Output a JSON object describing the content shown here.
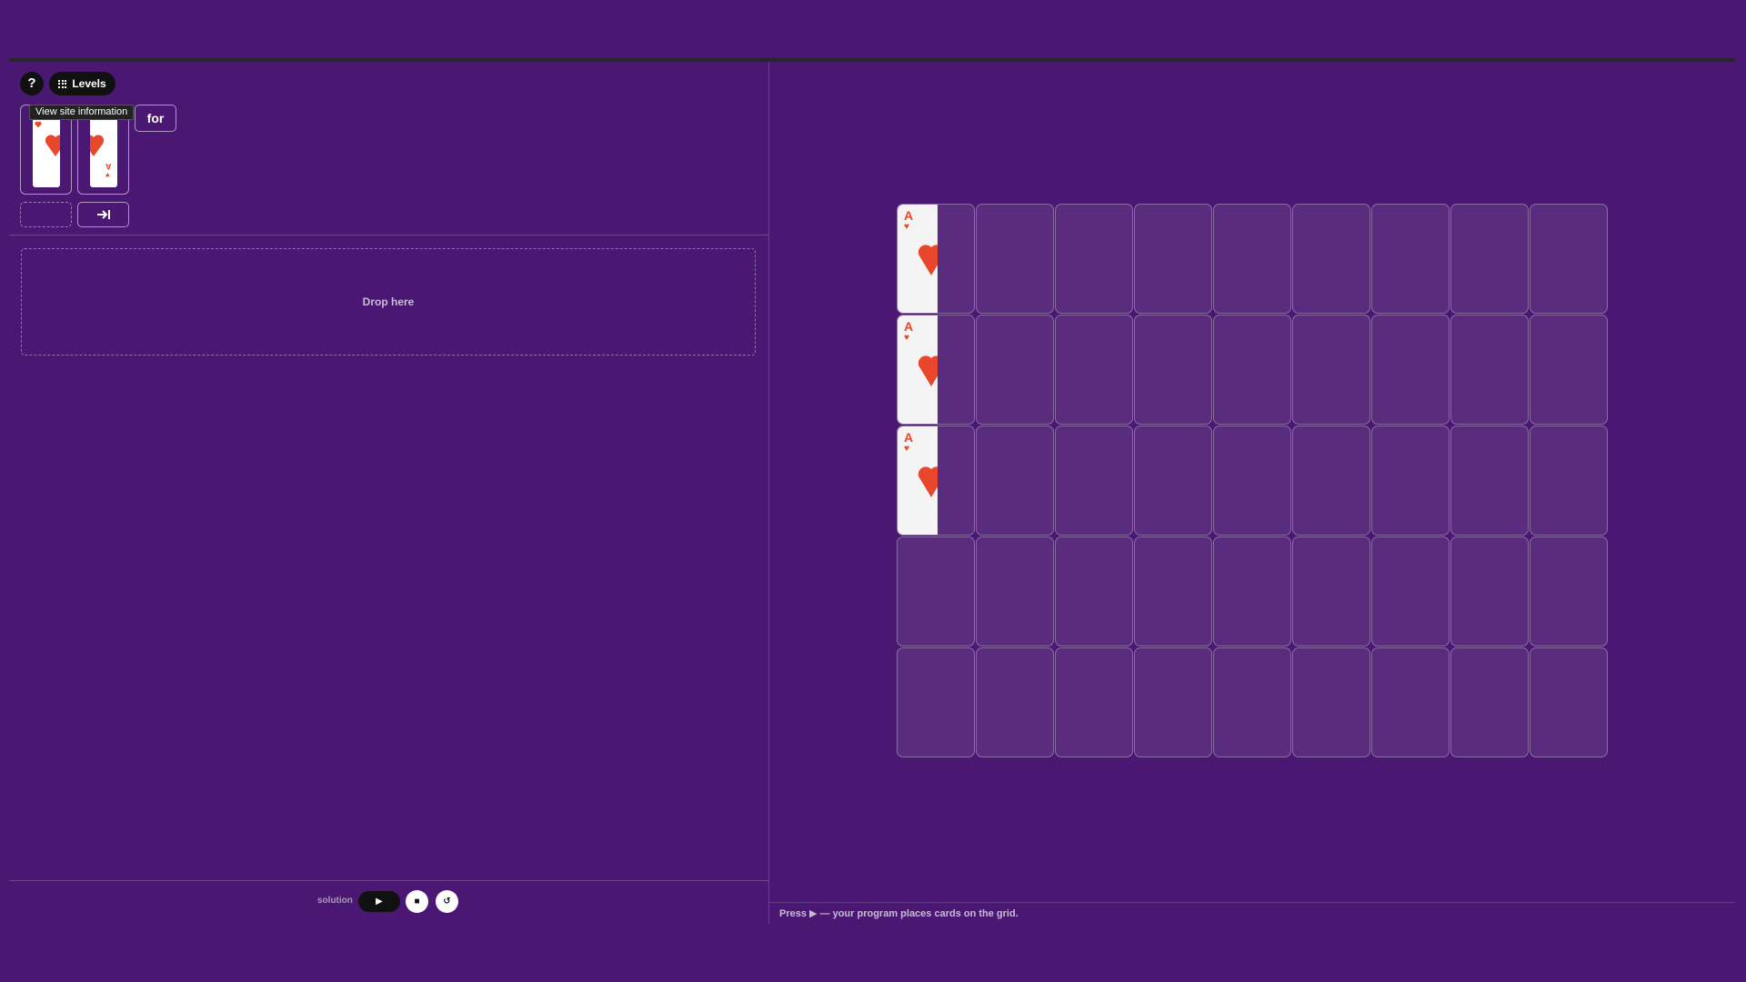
{
  "header": {
    "help_label": "?",
    "levels_label": "Levels",
    "levels_icon": "grid-icon"
  },
  "palette": {
    "tooltip": "View site information",
    "for_label": "for",
    "cards": [
      {
        "rank": "A",
        "suit": "♥",
        "color": "#e8472b"
      },
      {
        "rank": "A",
        "suit": "♥",
        "color": "#e8472b"
      }
    ],
    "tab_icon": "tab-arrow-icon"
  },
  "program": {
    "dropzone_label": "Drop here"
  },
  "controls": {
    "solution_label": "solution",
    "play_label": "▶",
    "stop_label": "■",
    "reset_label": "↺"
  },
  "board": {
    "columns": 9,
    "rows": 5,
    "placed": [
      {
        "row": 0,
        "col": 0,
        "rank": "A",
        "suit": "♥"
      },
      {
        "row": 1,
        "col": 0,
        "rank": "A",
        "suit": "♥"
      },
      {
        "row": 2,
        "col": 0,
        "rank": "A",
        "suit": "♥"
      }
    ]
  },
  "hint": "Press ▶ — your program places cards on the grid.",
  "colors": {
    "background": "#4a1872",
    "card_red": "#e8472b"
  }
}
